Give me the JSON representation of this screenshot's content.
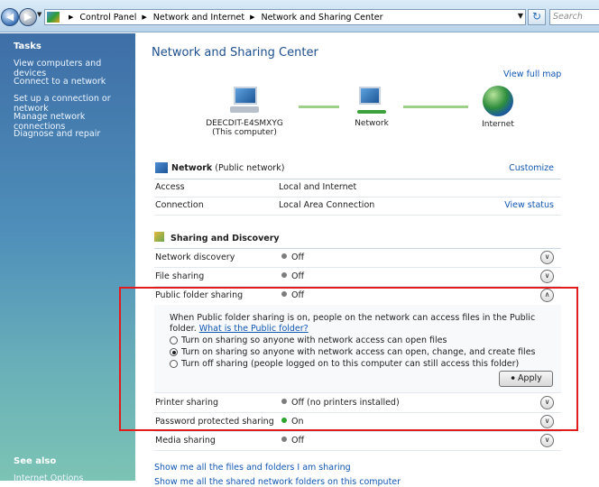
{
  "address": {
    "crumbs": [
      "Control Panel",
      "Network and Internet",
      "Network and Sharing Center"
    ],
    "search_placeholder": "Search"
  },
  "sidebar": {
    "heading": "Tasks",
    "items": [
      {
        "label": "View computers and devices"
      },
      {
        "label": "Connect to a network"
      },
      {
        "label": "Set up a connection or network"
      },
      {
        "label": "Manage network connections"
      },
      {
        "label": "Diagnose and repair"
      }
    ],
    "see_also": "See also",
    "internet_options": "Internet Options"
  },
  "main": {
    "title": "Network and Sharing Center",
    "view_full_map": "View full map",
    "map": {
      "computer_name": "DEECDIT-E4SMXYG",
      "computer_sub": "(This computer)",
      "network": "Network",
      "internet": "Internet"
    },
    "network": {
      "name": "Network",
      "type": "(Public network)",
      "customize": "Customize",
      "access_label": "Access",
      "access_value": "Local and Internet",
      "connection_label": "Connection",
      "connection_value": "Local Area Connection",
      "view_status": "View status"
    },
    "sharing": {
      "heading": "Sharing and Discovery",
      "rows": [
        {
          "label": "Network discovery",
          "status": "Off"
        },
        {
          "label": "File sharing",
          "status": "Off"
        },
        {
          "label": "Public folder sharing",
          "status": "Off"
        },
        {
          "label": "Printer sharing",
          "status": "Off (no printers installed)"
        },
        {
          "label": "Password protected sharing",
          "status": "On"
        },
        {
          "label": "Media sharing",
          "status": "Off"
        }
      ],
      "public_folder": {
        "description": "When Public folder sharing is on, people on the network can access files in the Public folder.",
        "what_link": "What is the Public folder?",
        "options": [
          {
            "label": "Turn on sharing so anyone with network access can open files"
          },
          {
            "label": "Turn on sharing so anyone with network access can open, change, and create files"
          },
          {
            "label": "Turn off sharing (people logged on to this computer can still access this folder)"
          }
        ],
        "selected_option": 1,
        "apply_label": "Apply"
      }
    },
    "show_files_link": "Show me all the files and folders I am sharing",
    "show_shared_folders_link": "Show me all the shared network folders on this computer"
  },
  "colors": {
    "highlight_border": "#e21c1c",
    "link": "#0f56b1",
    "title": "#1c4e8d",
    "status_on": "#2da52d",
    "status_off": "#7d7d7d"
  }
}
